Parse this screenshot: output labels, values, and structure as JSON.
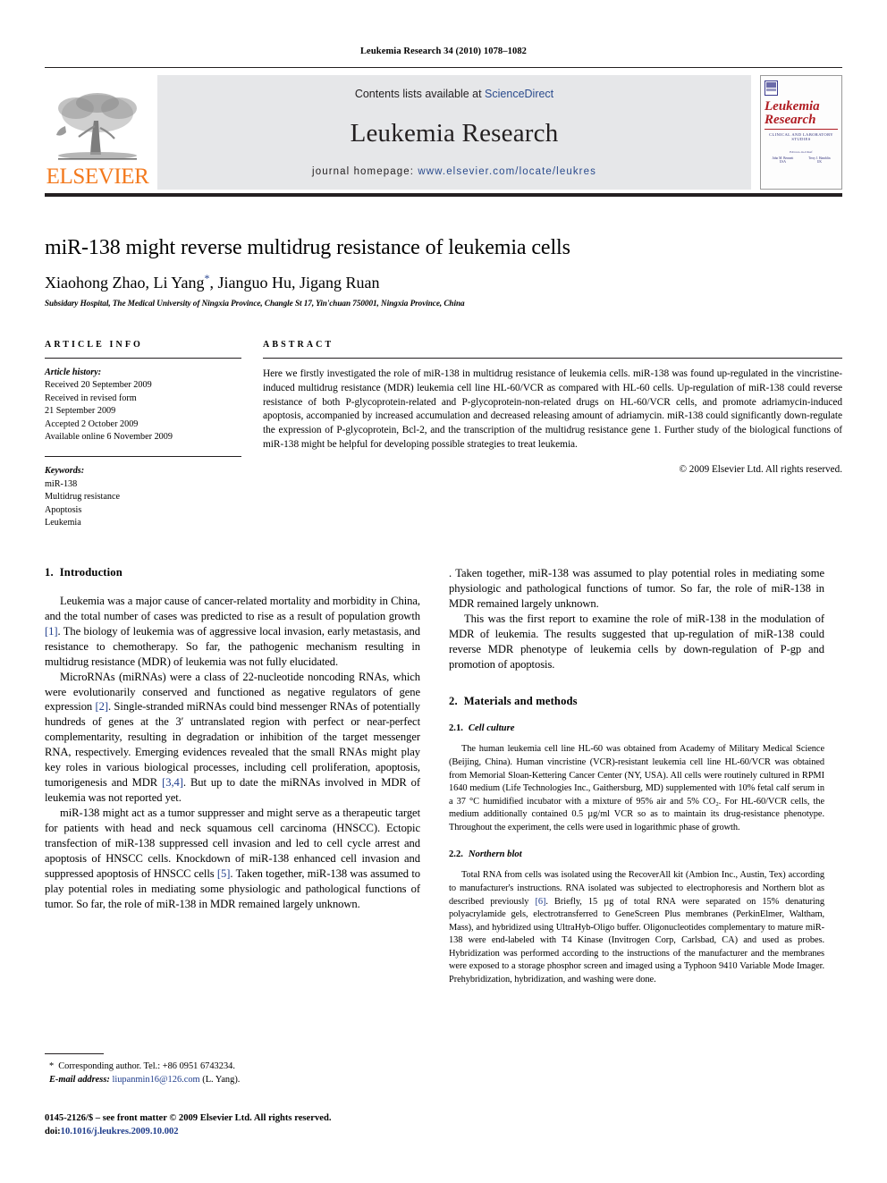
{
  "running_head": "Leukemia Research 34 (2010) 1078–1082",
  "masthead": {
    "publisher_word": "ELSEVIER",
    "contents_prefix": "Contents lists available at ",
    "contents_link": "ScienceDirect",
    "journal_name": "Leukemia Research",
    "homepage_prefix": "journal homepage: ",
    "homepage_url": "www.elsevier.com/locate/leukres",
    "cover": {
      "title_line1": "Leukemia",
      "title_line2": "Research",
      "subtitle": "CLINICAL AND LABORATORY STUDIES",
      "editors_label": "Editors-in-Chief",
      "editor1_name": "John M. Bennett",
      "editor1_loc": "USA",
      "editor2_name": "Terry J. Hamblin",
      "editor2_loc": "UK"
    }
  },
  "article": {
    "title": "miR-138 might reverse multidrug resistance of leukemia cells",
    "authors_part1": "Xiaohong Zhao, Li Yang",
    "authors_star": "*",
    "authors_part2": ", Jianguo Hu, Jigang Ruan",
    "affiliation": "Subsidary Hospital, The Medical University of Ningxia Province, Changle St 17, Yin'chuan 750001, Ningxia Province, China"
  },
  "article_info": {
    "heading": "ARTICLE INFO",
    "history_label": "Article history:",
    "history": [
      "Received 20 September 2009",
      "Received in revised form",
      "21 September 2009",
      "Accepted 2 October 2009",
      "Available online 6 November 2009"
    ],
    "keywords_label": "Keywords:",
    "keywords": [
      "miR-138",
      "Multidrug resistance",
      "Apoptosis",
      "Leukemia"
    ]
  },
  "abstract": {
    "heading": "ABSTRACT",
    "text": "Here we firstly investigated the role of miR-138 in multidrug resistance of leukemia cells. miR-138 was found up-regulated in the vincristine-induced multidrug resistance (MDR) leukemia cell line HL-60/VCR as compared with HL-60 cells. Up-regulation of miR-138 could reverse resistance of both P-glycoprotein-related and P-glycoprotein-non-related drugs on HL-60/VCR cells, and promote adriamycin-induced apoptosis, accompanied by increased accumulation and decreased releasing amount of adriamycin. miR-138 could significantly down-regulate the expression of P-glycoprotein, Bcl-2, and the transcription of the multidrug resistance gene 1. Further study of the biological functions of miR-138 might be helpful for developing possible strategies to treat leukemia.",
    "copyright": "© 2009 Elsevier Ltd. All rights reserved."
  },
  "body": {
    "intro_num": "1.",
    "intro_title": "Introduction",
    "p1_a": "Leukemia was a major cause of cancer-related mortality and morbidity in China, and the total number of cases was predicted to rise as a result of population growth ",
    "p1_ref": "[1]",
    "p1_b": ". The biology of leukemia was of aggressive local invasion, early metastasis, and resistance to chemotherapy. So far, the pathogenic mechanism resulting in multidrug resistance (MDR) of leukemia was not fully elucidated.",
    "p2_a": "MicroRNAs (miRNAs) were a class of 22-nucleotide noncoding RNAs, which were evolutionarily conserved and functioned as negative regulators of gene expression ",
    "p2_ref1": "[2]",
    "p2_b": ". Single-stranded miRNAs could bind messenger RNAs of potentially hundreds of genes at the 3′ untranslated region with perfect or near-perfect complementarity, resulting in degradation or inhibition of the target messenger RNA, respectively. Emerging evidences revealed that the small RNAs might play key roles in various biological processes, including cell proliferation, apoptosis, tumorigenesis and MDR ",
    "p2_ref2": "[3,4]",
    "p2_c": ". But up to date the miRNAs involved in MDR of leukemia was not reported yet.",
    "p3_a": "miR-138 might act as a tumor suppresser and might serve as a therapeutic target for patients with head and neck squamous cell carcinoma (HNSCC). Ectopic transfection of miR-138 suppressed cell invasion and led to cell cycle arrest and apoptosis of HNSCC cells. Knockdown of miR-138 enhanced cell invasion and suppressed apoptosis of HNSCC cells ",
    "p3_ref": "[5]",
    "p3_b": ". Taken together, miR-138 was assumed to play potential roles in mediating some physiologic and pathological functions of tumor. So far, the role of miR-138 in MDR remained largely unknown.",
    "p4": "This was the first report to examine the role of miR-138 in the modulation of MDR of leukemia. The results suggested that up-regulation of miR-138 could reverse MDR phenotype of leukemia cells by down-regulation of P-gp and promotion of apoptosis.",
    "methods_num": "2.",
    "methods_title": "Materials and methods",
    "cell_culture_num": "2.1.",
    "cell_culture_title": "Cell culture",
    "cell_culture_text": "The human leukemia cell line HL-60 was obtained from Academy of Military Medical Science (Beijing, China). Human vincristine (VCR)-resistant leukemia cell line HL-60/VCR was obtained from Memorial Sloan-Kettering Cancer Center (NY, USA). All cells were routinely cultured in RPMI 1640 medium (Life Technologies Inc., Gaithersburg, MD) supplemented with 10% fetal calf serum in a 37 °C humidified incubator with a mixture of 95% air and 5% CO₂. For HL-60/VCR cells, the medium additionally contained 0.5 µg/ml VCR so as to maintain its drug-resistance phenotype. Throughout the experiment, the cells were used in logarithmic phase of growth.",
    "northern_num": "2.2.",
    "northern_title": "Northern blot",
    "northern_text_a": "Total RNA from cells was isolated using the RecoverAll kit (Ambion Inc., Austin, Tex) according to manufacturer's instructions. RNA isolated was subjected to electrophoresis and Northern blot as described previously ",
    "northern_ref": "[6]",
    "northern_text_b": ". Briefly, 15 µg of total RNA were separated on 15% denaturing polyacrylamide gels, electrotransferred to GeneScreen Plus membranes (PerkinElmer, Waltham, Mass), and hybridized using UltraHyb-Oligo buffer. Oligonucleotides complementary to mature miR-138 were end-labeled with T4 Kinase (Invitrogen Corp, Carlsbad, CA) and used as probes. Hybridization was performed according to the instructions of the manufacturer and the membranes were exposed to a storage phosphor screen and imaged using a Typhoon 9410 Variable Mode Imager. Prehybridization, hybridization, and washing were done."
  },
  "footnotes": {
    "star": "*",
    "corresponding": "Corresponding author. Tel.: +86 0951 6743234.",
    "email_label": "E-mail address:",
    "email": "liupanmin16@126.com",
    "email_suffix": "(L. Yang).",
    "issn_line": "0145-2126/$ – see front matter © 2009 Elsevier Ltd. All rights reserved.",
    "doi_label": "doi:",
    "doi": "10.1016/j.leukres.2009.10.002"
  },
  "colors": {
    "link_blue": "#2a4b8d",
    "ref_blue": "#1f3d8c",
    "elsevier_orange": "#f3791d",
    "cover_red": "#b01c22",
    "band_gray": "#e6e7e9"
  }
}
